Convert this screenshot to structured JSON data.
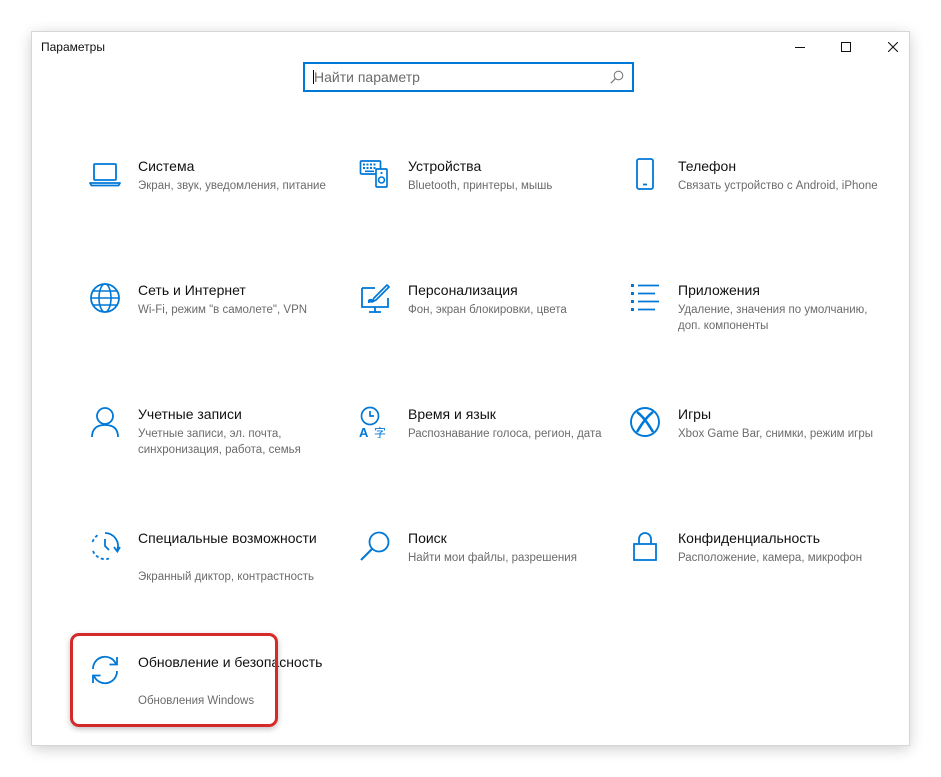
{
  "window": {
    "title": "Параметры",
    "controls": {
      "minimize": "minimize-icon",
      "maximize": "maximize-icon",
      "close": "close-icon"
    }
  },
  "search": {
    "placeholder": "Найти параметр",
    "icon": "search-icon",
    "accent": "#0078d7"
  },
  "tiles": [
    {
      "title": "Система",
      "description": "Экран, звук, уведомления, питание",
      "icon": "laptop-icon"
    },
    {
      "title": "Устройства",
      "description": "Bluetooth, принтеры, мышь",
      "icon": "devices-icon"
    },
    {
      "title": "Телефон",
      "description": "Связать устройство с Android, iPhone",
      "icon": "phone-icon"
    },
    {
      "title": "Сеть и Интернет",
      "description": "Wi-Fi, режим \"в самолете\", VPN",
      "icon": "globe-icon"
    },
    {
      "title": "Персонализация",
      "description": "Фон, экран блокировки, цвета",
      "icon": "personalization-icon"
    },
    {
      "title": "Приложения",
      "description": "Удаление, значения по умолчанию, доп. компоненты",
      "icon": "apps-list-icon"
    },
    {
      "title": "Учетные записи",
      "description": "Учетные записи, эл. почта, синхронизация, работа, семья",
      "icon": "person-icon"
    },
    {
      "title": "Время и язык",
      "description": "Распознавание голоса, регион, дата",
      "icon": "time-language-icon"
    },
    {
      "title": "Игры",
      "description": "Xbox Game Bar, снимки, режим игры",
      "icon": "xbox-icon"
    },
    {
      "title": "Специальные возможности",
      "description": "Экранный диктор, контрастность",
      "icon": "accessibility-icon"
    },
    {
      "title": "Поиск",
      "description": "Найти мои файлы, разрешения",
      "icon": "search-icon"
    },
    {
      "title": "Конфиденциальность",
      "description": "Расположение, камера, микрофон",
      "icon": "lock-icon"
    },
    {
      "title": "Обновление и безопасность",
      "description": "Обновления Windows",
      "icon": "sync-icon"
    }
  ],
  "colors": {
    "icon": "#0078d7",
    "highlight": "#d52a2a",
    "muted": "#6b6b6b"
  }
}
